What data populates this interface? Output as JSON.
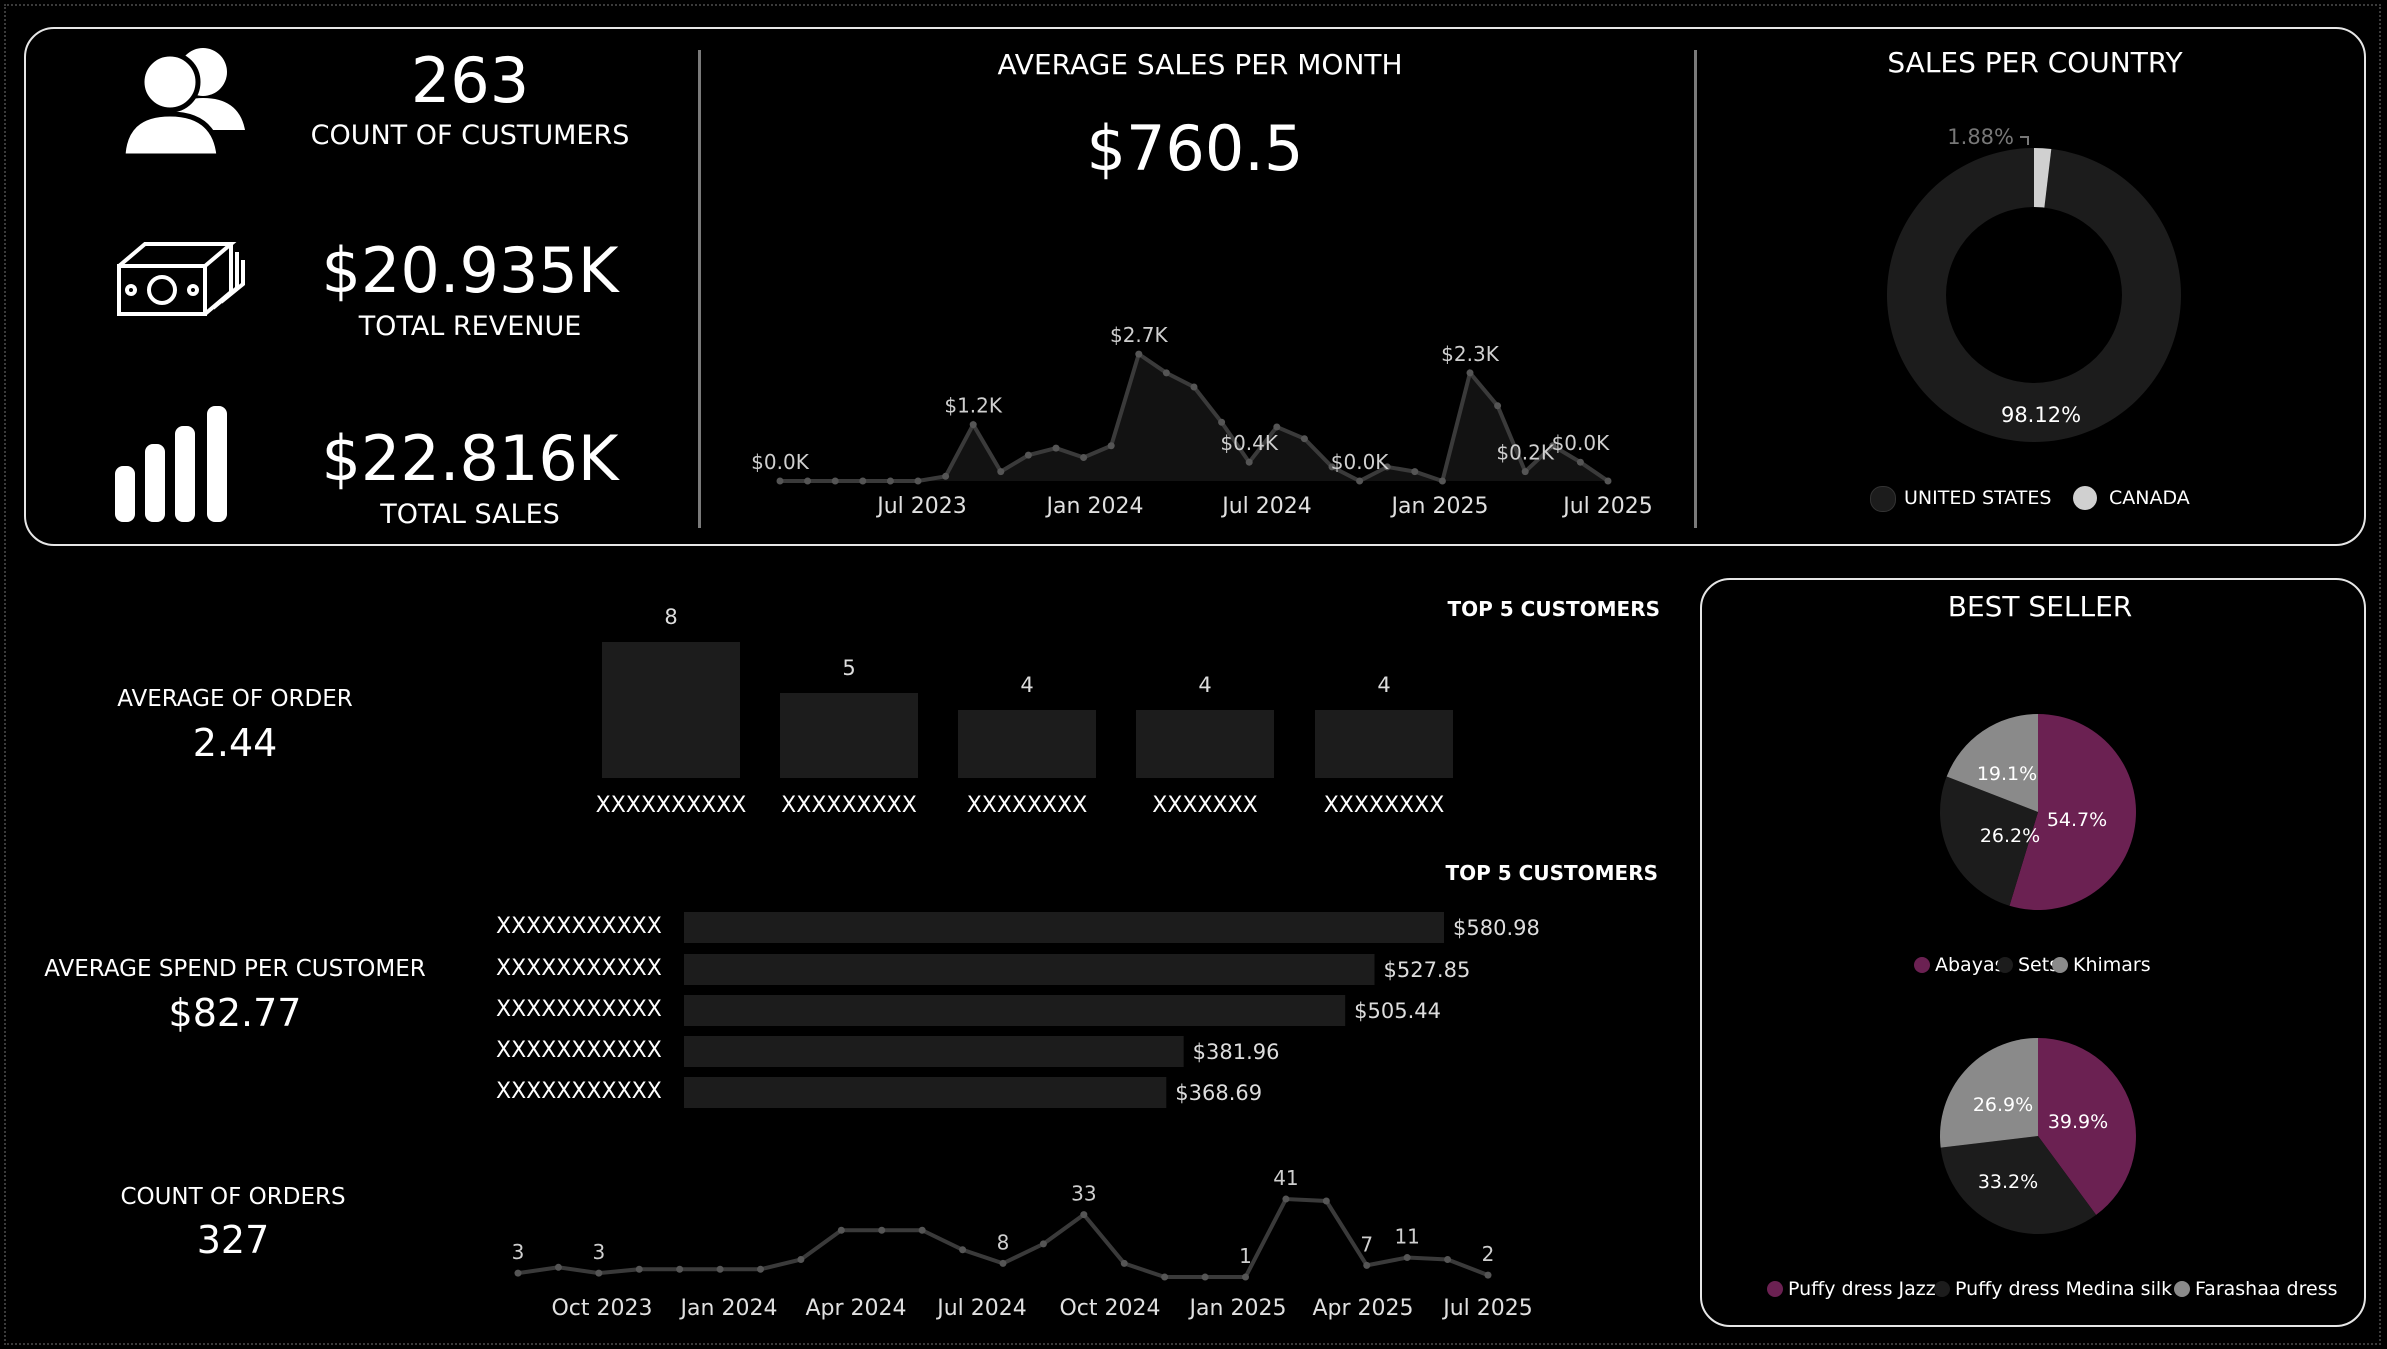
{
  "kpis": {
    "customers": {
      "value": "263",
      "label": "COUNT OF CUSTUMERS",
      "icon": "users-icon"
    },
    "revenue": {
      "value": "$20.935K",
      "label": "TOTAL REVENUE",
      "icon": "money-stack-icon"
    },
    "sales": {
      "value": "$22.816K",
      "label": "TOTAL SALES",
      "icon": "bar-chart-icon"
    }
  },
  "avg_sales": {
    "title": "AVERAGE SALES PER MONTH",
    "value": "$760.5"
  },
  "country": {
    "title": "SALES PER COUNTRY",
    "legend": [
      "UNITED STATES",
      "CANADA"
    ]
  },
  "left_stats": {
    "avg_order": {
      "label": "AVERAGE OF ORDER",
      "value": "2.44"
    },
    "avg_spend": {
      "label": "AVERAGE SPEND PER CUSTOMER",
      "value": "$82.77"
    },
    "count_orders": {
      "label": "COUNT OF ORDERS",
      "value": "327"
    }
  },
  "top_customers_title": "TOP 5 CUSTOMERS",
  "best_seller": {
    "title": "BEST SELLER"
  },
  "colors": {
    "background": "#000000",
    "panel_border": "#e6e6e6",
    "series_dark": "#1c1c1c",
    "line": "#3a3a3a",
    "accent_purple": "#6b2152",
    "gray": "#8a8a8a",
    "canada": "#d0d0d0"
  },
  "chart_data": [
    {
      "id": "avg_sales_month",
      "type": "area",
      "x_tick_labels": [
        "Jul 2023",
        "Jan 2024",
        "Jul 2024",
        "Jan 2025",
        "Jul 2025"
      ],
      "values": [
        0,
        0,
        0,
        0,
        0,
        0,
        0.1,
        1.2,
        0.2,
        0.55,
        0.7,
        0.5,
        0.75,
        2.7,
        2.3,
        2.0,
        1.25,
        0.4,
        1.15,
        0.9,
        0.3,
        0.0,
        0.3,
        0.2,
        0.0,
        2.3,
        1.6,
        0.2,
        0.75,
        0.4,
        0.0
      ],
      "data_labels": [
        {
          "index": 0,
          "text": "$0.0K"
        },
        {
          "index": 7,
          "text": "$1.2K"
        },
        {
          "index": 13,
          "text": "$2.7K"
        },
        {
          "index": 17,
          "text": "$0.4K"
        },
        {
          "index": 21,
          "text": "$0.0K"
        },
        {
          "index": 25,
          "text": "$2.3K"
        },
        {
          "index": 27,
          "text": "$0.2K"
        },
        {
          "index": 29,
          "text": "$0.0K"
        }
      ],
      "unit": "$K"
    },
    {
      "id": "sales_per_country",
      "type": "pie",
      "slices": [
        {
          "name": "UNITED STATES",
          "value": 98.12,
          "label": "98.12%"
        },
        {
          "name": "CANADA",
          "value": 1.88,
          "label": "1.88%"
        }
      ]
    },
    {
      "id": "top5_orders",
      "type": "bar",
      "title": "TOP 5 CUSTOMERS",
      "categories": [
        "XXXXXXXXXX",
        "XXXXXXXXX",
        "XXXXXXXX",
        "XXXXXXX",
        "XXXXXXXX"
      ],
      "values": [
        8,
        5,
        4,
        4,
        4
      ],
      "value_labels": [
        "8",
        "5",
        "4",
        "4",
        "4"
      ]
    },
    {
      "id": "top5_spend",
      "type": "bar",
      "orientation": "horizontal",
      "title": "TOP 5 CUSTOMERS",
      "categories": [
        "XXXXXXXXXXX",
        "XXXXXXXXXXX",
        "XXXXXXXXXXX",
        "XXXXXXXXXXX",
        "XXXXXXXXXXX"
      ],
      "values": [
        580.98,
        527.85,
        505.44,
        381.96,
        368.69
      ],
      "value_labels": [
        "$580.98",
        "$527.85",
        "$505.44",
        "$381.96",
        "$368.69"
      ]
    },
    {
      "id": "count_orders_trend",
      "type": "line",
      "x_tick_labels": [
        "Oct 2023",
        "Jan 2024",
        "Apr 2024",
        "Jul 2024",
        "Oct 2024",
        "Jan 2025",
        "Apr 2025",
        "Jul 2025"
      ],
      "values": [
        3,
        6,
        3,
        5,
        5,
        5,
        5,
        10,
        25,
        25,
        25,
        15,
        8,
        18,
        33,
        8,
        1,
        1,
        1,
        41,
        40,
        7,
        11,
        10,
        2
      ],
      "data_labels": [
        {
          "index": 0,
          "text": "3"
        },
        {
          "index": 2,
          "text": "3"
        },
        {
          "index": 12,
          "text": "8"
        },
        {
          "index": 14,
          "text": "33"
        },
        {
          "index": 18,
          "text": "1"
        },
        {
          "index": 19,
          "text": "41"
        },
        {
          "index": 21,
          "text": "7"
        },
        {
          "index": 22,
          "text": "11"
        },
        {
          "index": 24,
          "text": "2"
        }
      ]
    },
    {
      "id": "best_seller_category",
      "type": "pie",
      "slices": [
        {
          "name": "Abayas",
          "value": 54.7,
          "label": "54.7%"
        },
        {
          "name": "Sets",
          "value": 26.2,
          "label": "26.2%"
        },
        {
          "name": "Khimars",
          "value": 19.1,
          "label": "19.1%"
        }
      ]
    },
    {
      "id": "best_seller_product",
      "type": "pie",
      "slices": [
        {
          "name": "Puffy dress Jazz",
          "value": 39.9,
          "label": "39.9%"
        },
        {
          "name": "Puffy dress Medina silk",
          "value": 33.2,
          "label": "33.2%"
        },
        {
          "name": "Farashaa dress",
          "value": 26.9,
          "label": "26.9%"
        }
      ]
    }
  ]
}
